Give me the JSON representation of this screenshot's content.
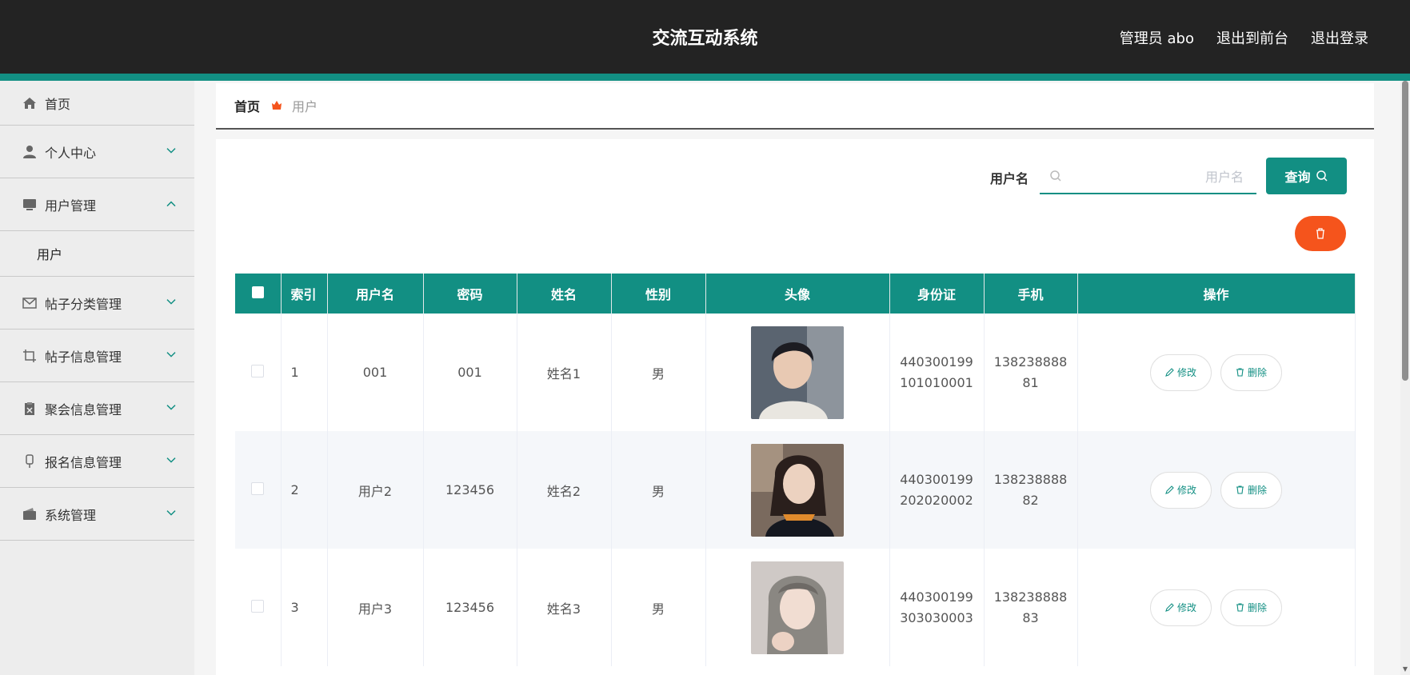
{
  "header": {
    "title": "交流互动系统",
    "admin_label": "管理员 abo",
    "to_front_label": "退出到前台",
    "logout_label": "退出登录",
    "accent_color": "#128f83"
  },
  "sidebar": {
    "items": [
      {
        "label": "首页",
        "icon": "home-icon"
      },
      {
        "label": "个人中心",
        "icon": "user-icon"
      },
      {
        "label": "用户管理",
        "icon": "monitor-icon",
        "expanded": true,
        "children": [
          "用户"
        ]
      },
      {
        "label": "帖子分类管理",
        "icon": "mail-icon"
      },
      {
        "label": "帖子信息管理",
        "icon": "crop-icon"
      },
      {
        "label": "聚会信息管理",
        "icon": "clipboard-icon"
      },
      {
        "label": "报名信息管理",
        "icon": "mic-icon"
      },
      {
        "label": "系统管理",
        "icon": "wallet-icon"
      }
    ]
  },
  "breadcrumb": {
    "home": "首页",
    "current": "用户"
  },
  "search": {
    "label": "用户名",
    "placeholder": "用户名",
    "button_label": "查询"
  },
  "table": {
    "columns": [
      "索引",
      "用户名",
      "密码",
      "姓名",
      "性别",
      "头像",
      "身份证",
      "手机",
      "操作"
    ],
    "rows": [
      {
        "index": "1",
        "username": "001",
        "password": "001",
        "name": "姓名1",
        "gender": "男",
        "id_card": "440300199101010001",
        "phone": "13823888881"
      },
      {
        "index": "2",
        "username": "用户2",
        "password": "123456",
        "name": "姓名2",
        "gender": "男",
        "id_card": "440300199202020002",
        "phone": "13823888882"
      },
      {
        "index": "3",
        "username": "用户3",
        "password": "123456",
        "name": "姓名3",
        "gender": "男",
        "id_card": "440300199303030003",
        "phone": "13823888883"
      }
    ],
    "edit_label": "修改",
    "delete_label": "删除"
  },
  "colors": {
    "header_bg": "#232323",
    "teal": "#128f83",
    "danger": "#f5541c"
  }
}
